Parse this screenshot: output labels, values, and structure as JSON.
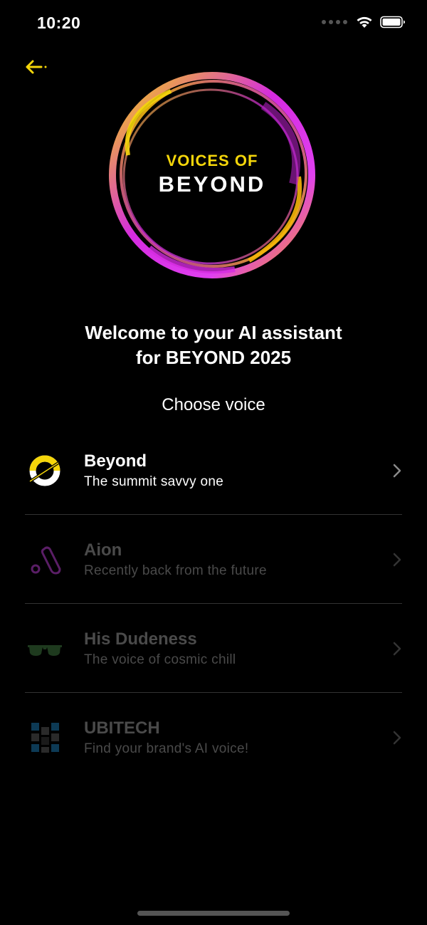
{
  "status_bar": {
    "time": "10:20"
  },
  "header": {
    "back_icon": "arrow-left-icon"
  },
  "logo": {
    "line1": "VOICES OF",
    "line2": "BEYOND"
  },
  "welcome": {
    "line1": "Welcome to your AI assistant",
    "line2": "for BEYOND 2025"
  },
  "choose_label": "Choose voice",
  "voices": [
    {
      "name": "Beyond",
      "description": "The summit savvy one",
      "icon": "beyond-logo-icon",
      "active": true
    },
    {
      "name": "Aion",
      "description": "Recently back from the future",
      "icon": "aion-logo-icon",
      "active": false
    },
    {
      "name": "His Dudeness",
      "description": "The voice of cosmic chill",
      "icon": "sunglasses-icon",
      "active": false
    },
    {
      "name": "UBITECH",
      "description": "Find your brand's AI voice!",
      "icon": "ubitech-logo-icon",
      "active": false
    }
  ],
  "colors": {
    "accent": "#F5D60A",
    "magenta": "#D52BE0",
    "background": "#000000"
  }
}
